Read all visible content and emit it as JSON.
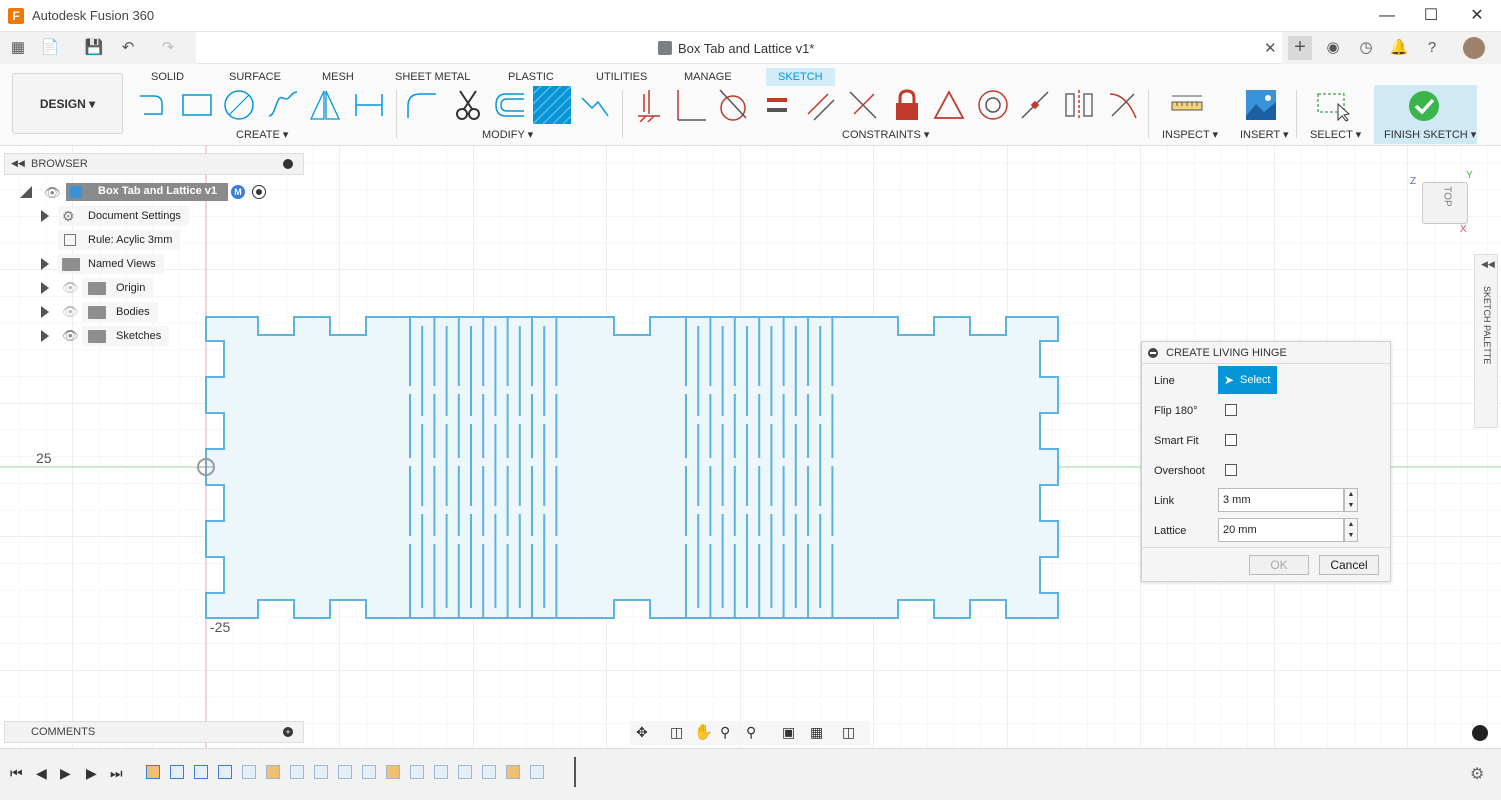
{
  "window": {
    "app_title": "Autodesk Fusion 360",
    "app_icon": "F",
    "document_title": "Box Tab and Lattice v1*",
    "controls": [
      "minimize-icon",
      "maximize-icon",
      "close-icon"
    ]
  },
  "workspace": {
    "design_label": "DESIGN",
    "tabs": [
      "SOLID",
      "SURFACE",
      "MESH",
      "SHEET METAL",
      "PLASTIC",
      "UTILITIES",
      "MANAGE",
      "SKETCH"
    ],
    "active_tab": "SKETCH",
    "groups": {
      "create": "CREATE",
      "modify": "MODIFY",
      "constraints": "CONSTRAINTS",
      "inspect": "INSPECT",
      "insert": "INSERT",
      "select": "SELECT",
      "finish": "FINISH SKETCH"
    }
  },
  "browser": {
    "title": "BROWSER",
    "root": "Box Tab and Lattice v1",
    "root_badge": "M",
    "items": [
      {
        "label": "Document Settings",
        "icon": "gear-icon"
      },
      {
        "label": "Rule: Acylic 3mm",
        "icon": "rule-icon"
      },
      {
        "label": "Named Views",
        "icon": "folder-icon"
      },
      {
        "label": "Origin",
        "icon": "folder-icon"
      },
      {
        "label": "Bodies",
        "icon": "folder-icon"
      },
      {
        "label": "Sketches",
        "icon": "folder-icon"
      }
    ]
  },
  "canvas": {
    "y_label_top": "25",
    "y_label_bottom": "-25",
    "viewcube_label": "TOP",
    "axis_z": "Z",
    "axis_y": "Y",
    "axis_x": "X",
    "palette_label": "SKETCH PALETTE"
  },
  "dialog": {
    "title": "CREATE LIVING HINGE",
    "line_label": "Line",
    "select_label": "Select",
    "flip_label": "Flip 180°",
    "smartfit_label": "Smart Fit",
    "overshoot_label": "Overshoot",
    "link_label": "Link",
    "link_value": "3 mm",
    "lattice_label": "Lattice",
    "lattice_value": "20 mm",
    "ok_label": "OK",
    "cancel_label": "Cancel"
  },
  "comments": {
    "title": "COMMENTS"
  },
  "colors": {
    "accent": "#0696d7",
    "sketch_line": "#5ab4df",
    "sketch_fill": "#edf6fb",
    "finish_check": "#39b54a",
    "constraint_red": "#c0392b"
  }
}
